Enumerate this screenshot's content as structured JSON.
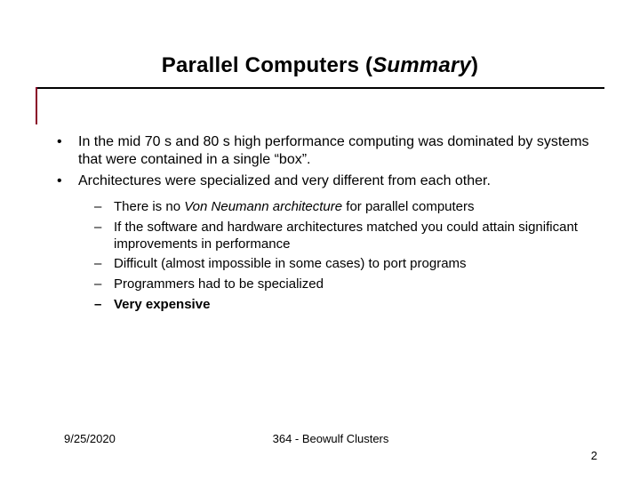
{
  "title": {
    "prefix": "Parallel Computers (",
    "summary": "Summary",
    "suffix": ")"
  },
  "bullets": {
    "b1": "In the mid 70 s and 80 s high performance computing was dominated by systems that were contained in a single “box”.",
    "b2": "Architectures were specialized and very different from each other.",
    "sub": {
      "s1_pre": "There is no ",
      "s1_vn": "Von Neumann architecture",
      "s1_post": " for parallel computers",
      "s2": "If the software and hardware architectures matched you could attain significant improvements in performance",
      "s3": "Difficult (almost impossible in some cases) to port programs",
      "s4": "Programmers had to be specialized",
      "s5": "Very expensive"
    }
  },
  "footer": {
    "date": "9/25/2020",
    "center": "364 - Beowulf Clusters",
    "page": "2"
  }
}
